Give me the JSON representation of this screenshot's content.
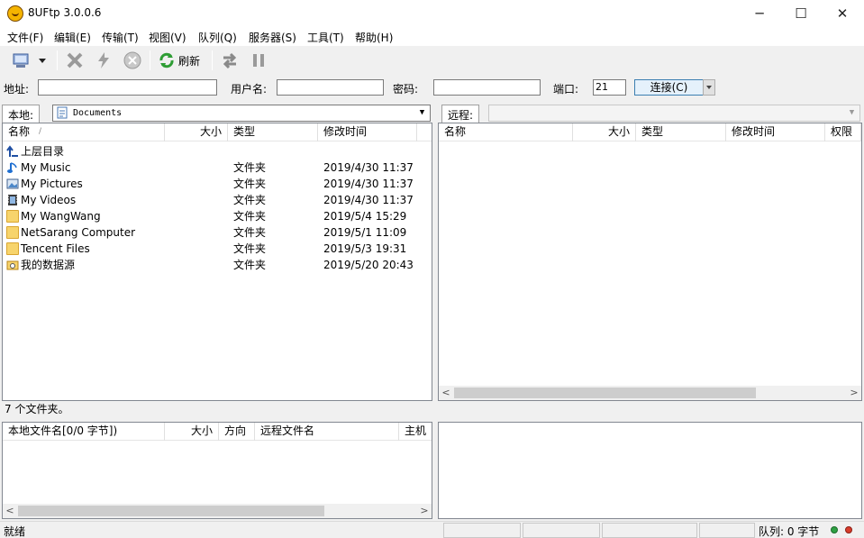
{
  "window": {
    "title": "8UFtp 3.0.0.6",
    "minimize": "─",
    "maximize": "☐",
    "close": "✕"
  },
  "menu": [
    "文件(F)",
    "编辑(E)",
    "传输(T)",
    "视图(V)",
    "队列(Q)",
    "服务器(S)",
    "工具(T)",
    "帮助(H)"
  ],
  "toolbar": {
    "refresh_label": "刷新"
  },
  "connection": {
    "address_label": "地址:",
    "address_value": "",
    "user_label": "用户名:",
    "user_value": "",
    "password_label": "密码:",
    "password_value": "",
    "port_label": "端口:",
    "port_value": "21",
    "connect_label": "连接(C)"
  },
  "local": {
    "tab_label": "本地:",
    "path": "Documents",
    "columns": {
      "name": "名称",
      "size": "大小",
      "type": "类型",
      "modified": "修改时间"
    },
    "parent_dir": "上层目录",
    "rows": [
      {
        "name": "My Music",
        "type": "文件夹",
        "date": "2019/4/30 11:37",
        "icon": "music-icon"
      },
      {
        "name": "My Pictures",
        "type": "文件夹",
        "date": "2019/4/30 11:37",
        "icon": "pictures-icon"
      },
      {
        "name": "My Videos",
        "type": "文件夹",
        "date": "2019/4/30 11:37",
        "icon": "videos-icon"
      },
      {
        "name": "My WangWang",
        "type": "文件夹",
        "date": "2019/5/4 15:29",
        "icon": "folder-icon"
      },
      {
        "name": "NetSarang Computer",
        "type": "文件夹",
        "date": "2019/5/1 11:09",
        "icon": "folder-icon"
      },
      {
        "name": "Tencent Files",
        "type": "文件夹",
        "date": "2019/5/3 19:31",
        "icon": "folder-icon"
      },
      {
        "name": "我的数据源",
        "type": "文件夹",
        "date": "2019/5/20 20:43",
        "icon": "datasource-folder-icon"
      }
    ],
    "status": "7 个文件夹。"
  },
  "remote": {
    "tab_label": "远程:",
    "path": "",
    "columns": {
      "name": "名称",
      "size": "大小",
      "type": "类型",
      "modified": "修改时间",
      "permissions": "权限"
    }
  },
  "queue": {
    "columns": {
      "local_file": "本地文件名[0/0 字节])",
      "size": "大小",
      "direction": "方向",
      "remote_file": "远程文件名",
      "host": "主机"
    }
  },
  "statusbar": {
    "ready": "就绪",
    "queue": "队列: 0 字节"
  },
  "colors": {
    "connect_border": "#3c7fb1",
    "led_green": "#2ea043",
    "led_red": "#d83b2b"
  }
}
